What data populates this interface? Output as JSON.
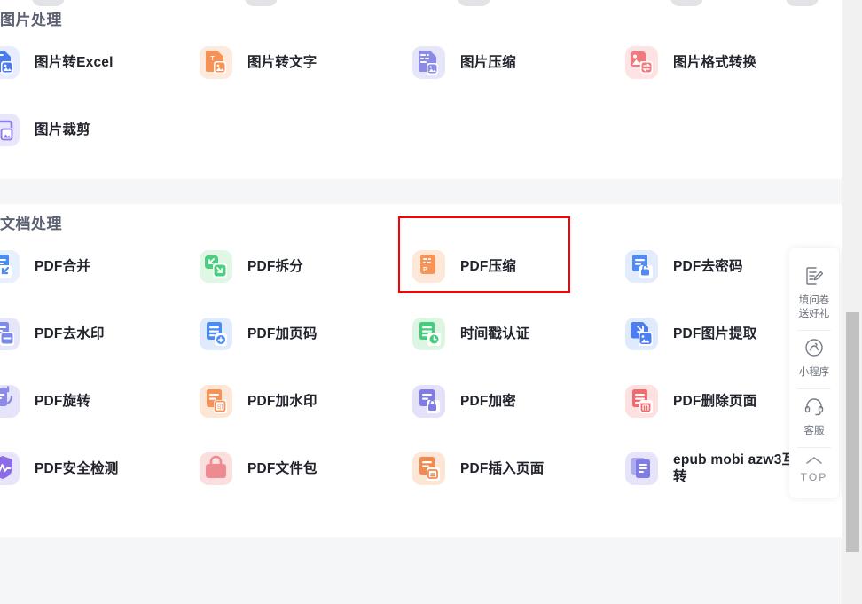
{
  "page": {
    "background": "#f5f6f8",
    "card_background": "#ffffff"
  },
  "sections": [
    {
      "id": "image-processing",
      "title": "图片处理",
      "tools": [
        {
          "label": "图片转Excel",
          "icon": "image-to-excel-icon",
          "bg": "#e8edfd",
          "fg": "#4b7bec"
        },
        {
          "label": "图片转文字",
          "icon": "image-to-text-icon",
          "bg": "#fdeadd",
          "fg": "#f79256"
        },
        {
          "label": "图片压缩",
          "icon": "image-compress-icon",
          "bg": "#e6e6fb",
          "fg": "#8b8ae8"
        },
        {
          "label": "图片格式转换",
          "icon": "image-format-icon",
          "bg": "#fde3e3",
          "fg": "#f2787c"
        },
        {
          "label": "图片裁剪",
          "icon": "image-crop-icon",
          "bg": "#e8e6fb",
          "fg": "#8d7ce6"
        }
      ]
    },
    {
      "id": "document-processing",
      "title": "文档处理",
      "tools": [
        {
          "label": "PDF合并",
          "icon": "pdf-merge-icon",
          "bg": "#e8f0fd",
          "fg": "#4b8bf4"
        },
        {
          "label": "PDF拆分",
          "icon": "pdf-split-icon",
          "bg": "#e0f7e6",
          "fg": "#4ccd7f"
        },
        {
          "label": "PDF压缩",
          "icon": "pdf-compress-icon",
          "bg": "#fde8d9",
          "fg": "#f89454",
          "highlighted": true
        },
        {
          "label": "PDF去密码",
          "icon": "pdf-unlock-icon",
          "bg": "#e2ecfd",
          "fg": "#4f8bf0"
        },
        {
          "label": "PDF去水印",
          "icon": "pdf-remove-mark-icon",
          "bg": "#e6e6fb",
          "fg": "#7c8bea"
        },
        {
          "label": "PDF加页码",
          "icon": "pdf-page-number-icon",
          "bg": "#dfeafd",
          "fg": "#4b8bf4"
        },
        {
          "label": "时间戳认证",
          "icon": "timestamp-icon",
          "bg": "#ddf6e4",
          "fg": "#45cc7c"
        },
        {
          "label": "PDF图片提取",
          "icon": "pdf-extract-image-icon",
          "bg": "#dfeafd",
          "fg": "#4b7ef0"
        },
        {
          "label": "PDF旋转",
          "icon": "pdf-rotate-icon",
          "bg": "#e6e4fb",
          "fg": "#8b8ae8"
        },
        {
          "label": "PDF加水印",
          "icon": "pdf-watermark-icon",
          "bg": "#fde6d5",
          "fg": "#f79256"
        },
        {
          "label": "PDF加密",
          "icon": "pdf-encrypt-icon",
          "bg": "#e4e2fb",
          "fg": "#7f7ce6"
        },
        {
          "label": "PDF删除页面",
          "icon": "pdf-delete-page-icon",
          "bg": "#fde0e0",
          "fg": "#f2696e"
        },
        {
          "label": "PDF安全检测",
          "icon": "pdf-security-icon",
          "bg": "#e7e4fb",
          "fg": "#8b6ce8"
        },
        {
          "label": "PDF文件包",
          "icon": "pdf-package-icon",
          "bg": "#fbdede",
          "fg": "#ee8b92"
        },
        {
          "label": "PDF插入页面",
          "icon": "pdf-insert-page-icon",
          "bg": "#fde6d5",
          "fg": "#f18a4e"
        },
        {
          "label": "epub mobi azw3互转",
          "icon": "ebook-convert-icon",
          "bg": "#e6e4fb",
          "fg": "#7f7ce6"
        }
      ]
    }
  ],
  "side_widget": {
    "items": [
      {
        "id": "survey",
        "icon": "survey-pen-icon",
        "label": "填问卷\n送好礼"
      },
      {
        "id": "miniapp",
        "icon": "miniprogram-icon",
        "label": "小程序"
      },
      {
        "id": "support",
        "icon": "headset-icon",
        "label": "客服"
      },
      {
        "id": "top",
        "icon": "chevron-up-icon",
        "label": "TOP"
      }
    ]
  },
  "highlight": {
    "color": "#ff0000",
    "target_label": "PDF压缩"
  },
  "scrollbar": {
    "track_color": "#f1f1f1",
    "thumb_color": "#c1c1c1"
  }
}
